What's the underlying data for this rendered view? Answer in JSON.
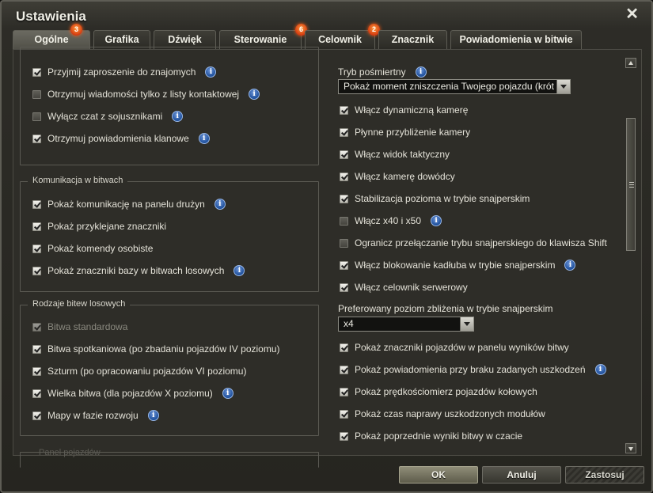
{
  "window": {
    "title": "Ustawienia"
  },
  "tabs": [
    {
      "label": "Ogólne",
      "badge": "3"
    },
    {
      "label": "Grafika"
    },
    {
      "label": "Dźwięk"
    },
    {
      "label": "Sterowanie",
      "badge": "6"
    },
    {
      "label": "Celownik",
      "badge": "2"
    },
    {
      "label": "Znacznik"
    },
    {
      "label": "Powiadomienia w bitwie"
    }
  ],
  "left": {
    "group1": {
      "items": [
        {
          "label": "Przyjmij zaproszenie do znajomych",
          "checked": true,
          "info": true
        },
        {
          "label": "Otrzymuj wiadomości tylko z listy kontaktowej",
          "checked": false,
          "info": true
        },
        {
          "label": "Wyłącz czat z sojusznikami",
          "checked": false,
          "info": true
        },
        {
          "label": "Otrzymuj powiadomienia klanowe",
          "checked": true,
          "info": true
        }
      ]
    },
    "group2": {
      "title": "Komunikacja w bitwach",
      "items": [
        {
          "label": "Pokaż komunikację na panelu drużyn",
          "checked": true,
          "info": true
        },
        {
          "label": "Pokaż przyklejane znaczniki",
          "checked": true
        },
        {
          "label": "Pokaż komendy osobiste",
          "checked": true
        },
        {
          "label": "Pokaż znaczniki bazy w bitwach losowych",
          "checked": true,
          "info": true
        }
      ]
    },
    "group3": {
      "title": "Rodzaje bitew losowych",
      "items": [
        {
          "label": "Bitwa standardowa",
          "checked": true,
          "disabled": true
        },
        {
          "label": "Bitwa spotkaniowa (po zbadaniu pojazdów IV poziomu)",
          "checked": true
        },
        {
          "label": "Szturm (po opracowaniu pojazdów VI poziomu)",
          "checked": true
        },
        {
          "label": "Wielka bitwa (dla pojazdów X poziomu)",
          "checked": true,
          "info": true
        },
        {
          "label": "Mapy w fazie rozwoju",
          "checked": true,
          "info": true
        }
      ]
    },
    "group4": {
      "title": "Panel pojazdów"
    }
  },
  "right": {
    "postmortem_label": "Tryb pośmiertny",
    "postmortem_value": "Pokaż moment zniszczenia Twojego pojazdu (krót",
    "camera_items": [
      {
        "label": "Włącz dynamiczną kamerę",
        "checked": true
      },
      {
        "label": "Płynne przybliżenie kamery",
        "checked": true
      },
      {
        "label": "Włącz widok taktyczny",
        "checked": true
      },
      {
        "label": "Włącz kamerę dowódcy",
        "checked": true
      },
      {
        "label": "Stabilizacja pozioma w trybie snajperskim",
        "checked": true
      },
      {
        "label": "Włącz x40 i x50",
        "checked": false,
        "info": true
      },
      {
        "label": "Ogranicz przełączanie trybu snajperskiego do klawisza Shift",
        "checked": false
      },
      {
        "label": "Włącz blokowanie kadłuba w trybie snajperskim",
        "checked": true,
        "info": true
      },
      {
        "label": "Włącz celownik serwerowy",
        "checked": true
      }
    ],
    "zoom_label": "Preferowany poziom zbliżenia w trybie snajperskim",
    "zoom_value": "x4",
    "battle_items": [
      {
        "label": "Pokaż znaczniki pojazdów w panelu wyników bitwy",
        "checked": true
      },
      {
        "label": "Pokaż powiadomienia przy braku zadanych uszkodzeń",
        "checked": true,
        "info": true
      },
      {
        "label": "Pokaż prędkościomierz pojazdów kołowych",
        "checked": true
      },
      {
        "label": "Pokaż czas naprawy uszkodzonych modułów",
        "checked": true
      },
      {
        "label": "Pokaż poprzednie wyniki bitwy w czacie",
        "checked": true
      }
    ]
  },
  "info_glyph": "i",
  "footer": {
    "ok": "OK",
    "cancel": "Anuluj",
    "apply": "Zastosuj"
  },
  "icons": {
    "close": "close-icon",
    "info": "info-icon",
    "checkbox": "checkbox-icon",
    "dropdown": "chevron-down-icon"
  },
  "colors": {
    "badge": "#e8501a",
    "info": "#2f63b8",
    "background": "#2e2d28"
  }
}
